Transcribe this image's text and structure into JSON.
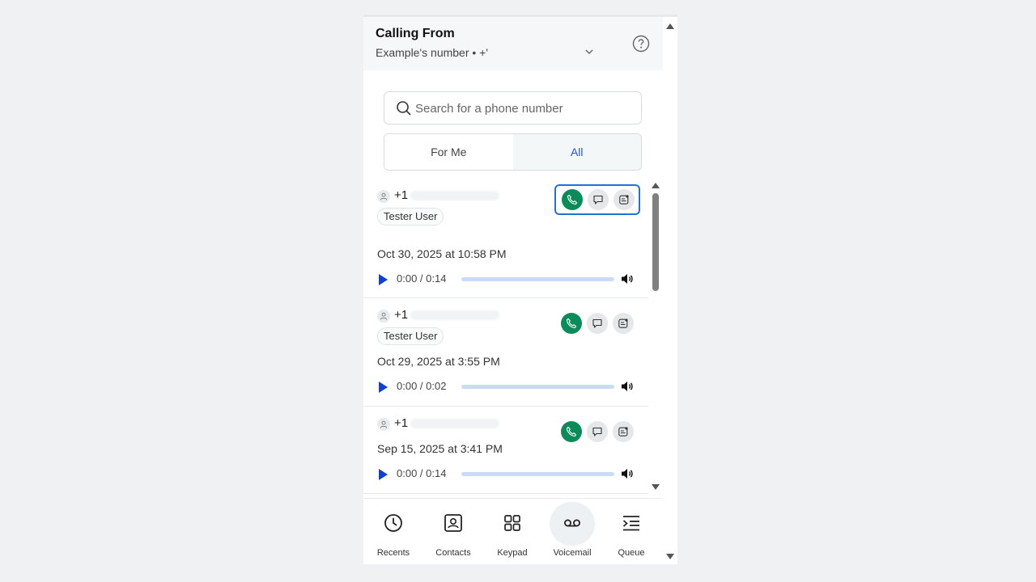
{
  "header": {
    "title": "Calling From",
    "subtitle": "Example's number • +'"
  },
  "search": {
    "placeholder": "Search for a phone number"
  },
  "filter": {
    "options": [
      "For Me",
      "All"
    ],
    "selected": "All"
  },
  "voicemails": [
    {
      "number": "+1",
      "tag": "Tester User",
      "date": "Oct 30, 2025 at 10:58 PM",
      "time": "0:00 / 0:14"
    },
    {
      "number": "+1",
      "tag": "Tester User",
      "date": "Oct 29, 2025 at 3:55 PM",
      "time": "0:00 / 0:02"
    },
    {
      "number": "+1",
      "tag": "",
      "date": "Sep 15, 2025 at 3:41 PM",
      "time": "0:00 / 0:14"
    }
  ],
  "nav": {
    "items": [
      {
        "label": "Recents",
        "icon": "clock-icon"
      },
      {
        "label": "Contacts",
        "icon": "contact-card-icon"
      },
      {
        "label": "Keypad",
        "icon": "grid-icon"
      },
      {
        "label": "Voicemail",
        "icon": "voicemail-icon"
      },
      {
        "label": "Queue",
        "icon": "queue-icon"
      }
    ],
    "active": "Voicemail"
  },
  "colors": {
    "accent": "#1e5bb8",
    "call": "#0b8a5a",
    "play": "#1040d8",
    "focus": "#1e74d6"
  }
}
